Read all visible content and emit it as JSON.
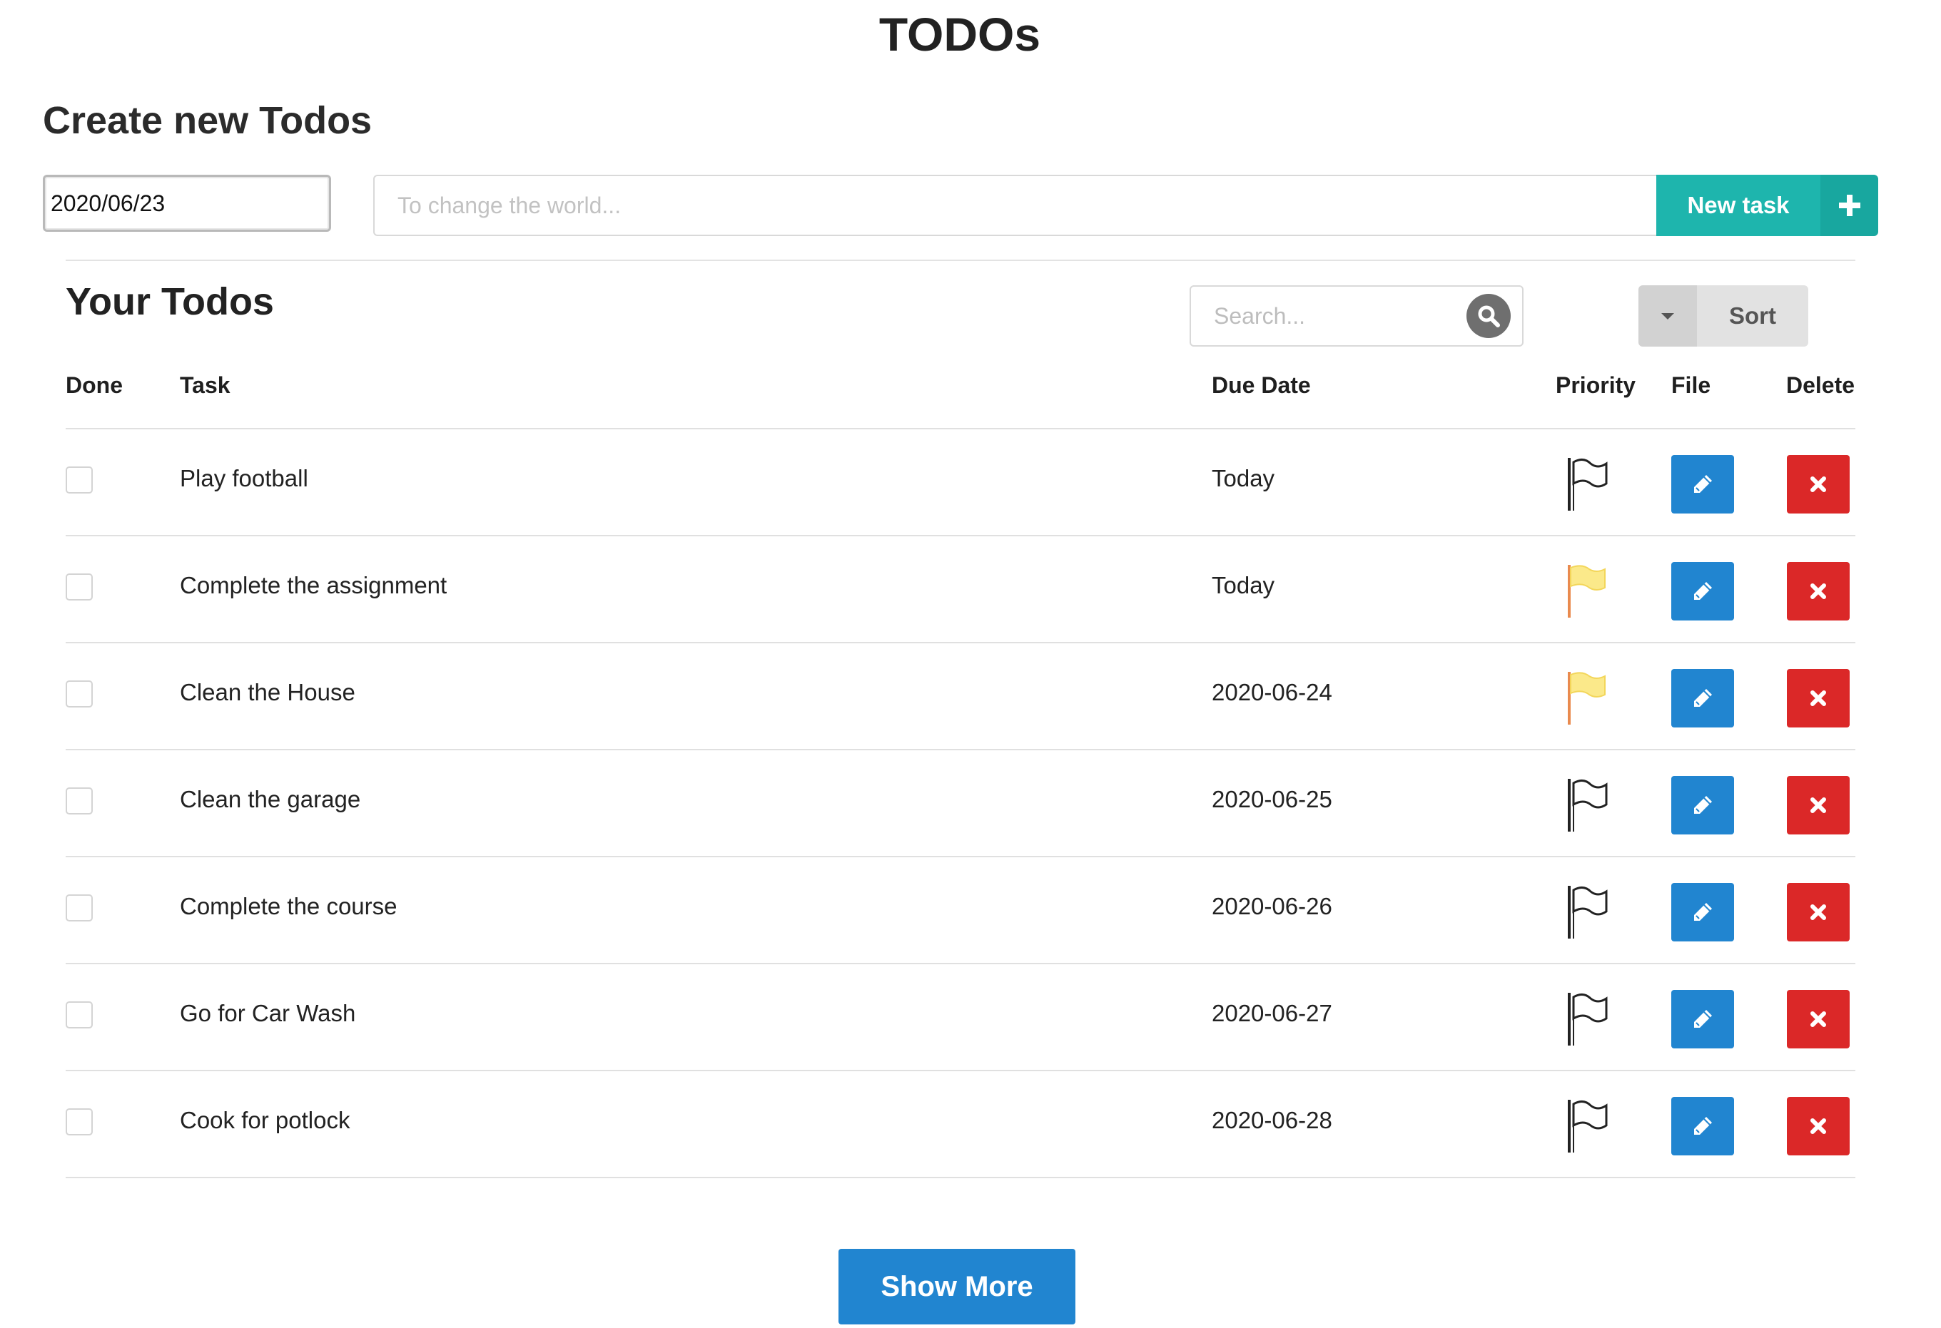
{
  "app": {
    "title": "TODOs"
  },
  "create": {
    "title": "Create new Todos",
    "date_value": "2020/06/23",
    "task_placeholder": "To change the world...",
    "new_task_label": "New task",
    "add_icon": "plus-icon",
    "accent_color": "#1eb5ad"
  },
  "list": {
    "title": "Your Todos",
    "search_placeholder": "Search...",
    "search_icon": "search-icon",
    "sort_label": "Sort",
    "sort_icon": "caret-down-icon",
    "columns": {
      "done": "Done",
      "task": "Task",
      "due": "Due Date",
      "priority": "Priority",
      "file": "File",
      "delete": "Delete"
    },
    "rows": [
      {
        "done": false,
        "task": "Play football",
        "due": "Today",
        "priority_flag": "white"
      },
      {
        "done": false,
        "task": "Complete the assignment",
        "due": "Today",
        "priority_flag": "yellow"
      },
      {
        "done": false,
        "task": "Clean the House",
        "due": "2020-06-24",
        "priority_flag": "yellow"
      },
      {
        "done": false,
        "task": "Clean the garage",
        "due": "2020-06-25",
        "priority_flag": "white"
      },
      {
        "done": false,
        "task": "Complete the course",
        "due": "2020-06-26",
        "priority_flag": "white"
      },
      {
        "done": false,
        "task": "Go for Car Wash",
        "due": "2020-06-27",
        "priority_flag": "white"
      },
      {
        "done": false,
        "task": "Cook for potlock",
        "due": "2020-06-28",
        "priority_flag": "white"
      }
    ],
    "edit_icon": "pencil-icon",
    "delete_icon": "close-icon",
    "edit_color": "#2185d0",
    "delete_color": "#db2828",
    "show_more_label": "Show More"
  }
}
